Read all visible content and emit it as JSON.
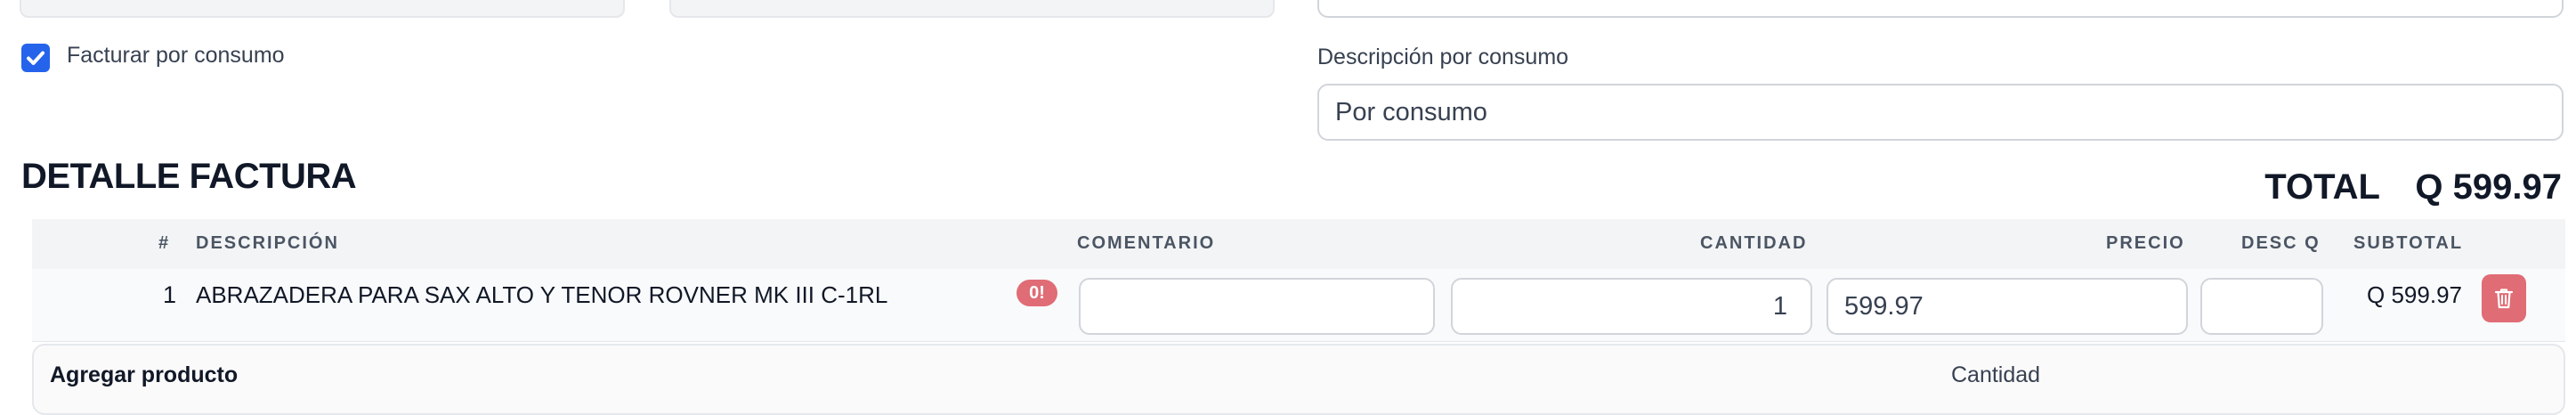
{
  "form": {
    "bill_by_consumption_label": "Facturar por consumo",
    "bill_by_consumption_checked": true,
    "consumption_description_label": "Descripción por consumo",
    "consumption_description_value": "Por consumo"
  },
  "invoice": {
    "section_title": "DETALLE FACTURA",
    "total_label": "TOTAL",
    "total_value": "Q 599.97",
    "columns": {
      "num": "#",
      "description": "DESCRIPCIÓN",
      "comment": "COMENTARIO",
      "quantity": "CANTIDAD",
      "price": "PRECIO",
      "discount": "DESC Q",
      "subtotal": "SUBTOTAL"
    },
    "rows": [
      {
        "num": "1",
        "description": "ABRAZADERA PARA SAX ALTO Y TENOR ROVNER MK III C-1RL",
        "badge": "0!",
        "comment": "",
        "quantity": "1",
        "price": "599.97",
        "discount": "",
        "subtotal": "Q 599.97"
      }
    ]
  },
  "add_product": {
    "title": "Agregar producto",
    "quantity_label": "Cantidad"
  },
  "colors": {
    "accent": "#2563eb",
    "danger": "#e06c75",
    "header_bg": "#f3f4f6"
  },
  "icons": {
    "delete": "trash-icon",
    "checkbox": "check-icon"
  }
}
